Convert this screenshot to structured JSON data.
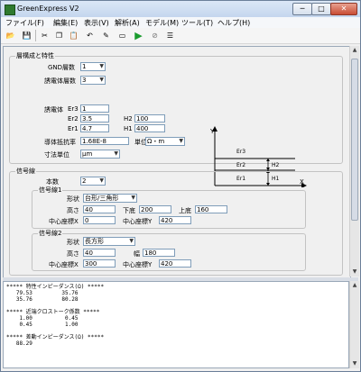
{
  "window": {
    "title": "GreenExpress V2",
    "minimize": "─",
    "maximize": "□",
    "close": "✕"
  },
  "menu": [
    "ファイル(F)",
    "編集(E)",
    "表示(V)",
    "解析(A)",
    "モデル(M)",
    "ツール(T)",
    "ヘルプ(H)"
  ],
  "toolbar": {
    "icons": [
      "open-icon",
      "save-icon",
      "cut-icon",
      "copy-icon",
      "paste-icon",
      "undo-icon",
      "edit-icon",
      "model-icon",
      "run-icon",
      "stop-icon",
      "list-icon"
    ],
    "glyphs": [
      "📂",
      "💾",
      "✂",
      "❐",
      "📋",
      "↶",
      "✎",
      "▭",
      "▶",
      "⊘",
      "☰"
    ],
    "run_color": "#1a9b2e"
  },
  "layer": {
    "group_label": "層構成と特性",
    "gnd_label": "GND層数",
    "gnd_value": "1",
    "diel_label": "誘電体層数",
    "diel_value": "3",
    "diel_prop_label": "誘電体",
    "er3_label": "Er3",
    "er3_value": "1",
    "er2_label": "Er2",
    "er2_value": "3.5",
    "h2_label": "H2",
    "h2_value": "100",
    "er1_label": "Er1",
    "er1_value": "4.7",
    "h1_label": "H1",
    "h1_value": "400",
    "resistivity_label": "導体抵抗率",
    "resistivity_value": "1.68E-8",
    "unit_label": "単位",
    "unit_value": "Ω・m",
    "dim_unit_label": "寸法単位",
    "dim_unit_value": "μm"
  },
  "diagram": {
    "y_axis": "Y",
    "x_axis": "X",
    "er3": "Er3",
    "er2": "Er2",
    "er1": "Er1",
    "h2": "H2",
    "h1": "H1"
  },
  "signal": {
    "group_label": "信号線",
    "count_label": "本数",
    "count_value": "2",
    "line1": {
      "label": "信号線1",
      "shape_label": "形状",
      "shape_value": "台形/三角形",
      "height_label": "高さ",
      "height_value": "40",
      "bottom_label": "下底",
      "bottom_value": "200",
      "top_label": "上底",
      "top_value": "160",
      "cx_label": "中心座標X",
      "cx_value": "0",
      "cy_label": "中心座標Y",
      "cy_value": "420"
    },
    "line2": {
      "label": "信号線2",
      "shape_label": "形状",
      "shape_value": "長方形",
      "height_label": "高さ",
      "height_value": "40",
      "width_label": "幅",
      "width_value": "180",
      "cx_label": "中心座標X",
      "cx_value": "300",
      "cy_label": "中心座標Y",
      "cy_value": "420"
    }
  },
  "log": {
    "text": "***** 特性インピーダンス(Ω) *****\n   79.53         35.76\n   35.76         80.28\n\n***** 近端クロストーク係数 *****\n    1.00          0.45\n    0.45          1.00\n\n***** 差動インピーダンス(Ω) *****\n   88.29"
  }
}
